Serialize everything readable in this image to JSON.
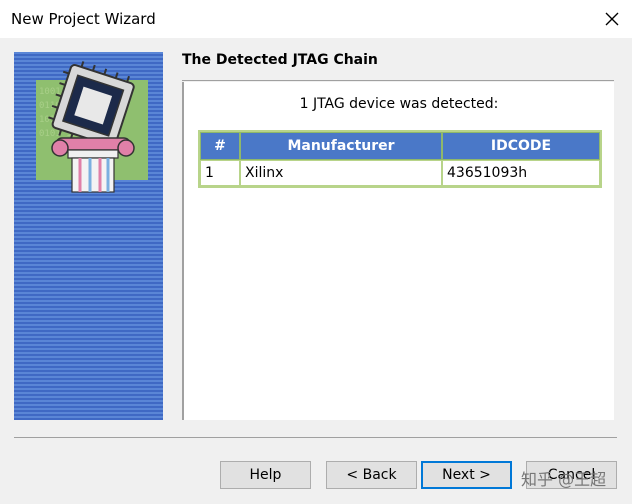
{
  "window": {
    "title": "New Project Wizard"
  },
  "page": {
    "heading": "The Detected JTAG Chain",
    "detected_text": "1 JTAG device was detected:"
  },
  "table": {
    "headers": [
      "#",
      "Manufacturer",
      "IDCODE"
    ],
    "rows": [
      {
        "num": "1",
        "manufacturer": "Xilinx",
        "idcode": "43651093h"
      }
    ]
  },
  "buttons": {
    "help": "Help",
    "back": "< Back",
    "next": "Next >",
    "cancel": "Cancel"
  },
  "watermark": "知乎 @王超",
  "colors": {
    "table_header": "#4a78c8",
    "table_border": "#b8d48a",
    "banner": "#4a72c8",
    "default_button_border": "#0078d7"
  }
}
